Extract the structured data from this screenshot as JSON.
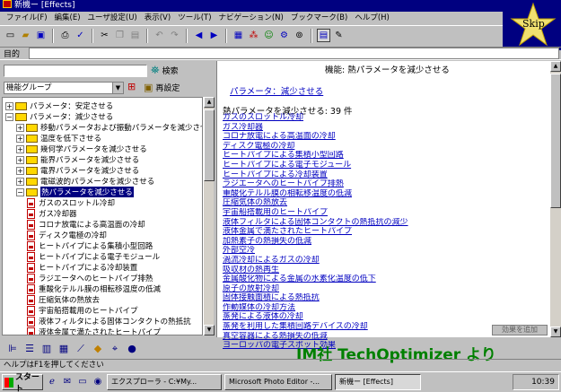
{
  "window": {
    "title": "新機ー [Effects]"
  },
  "menu": [
    "ファイル(F)",
    "編集(E)",
    "ユーザ設定(U)",
    "表示(V)",
    "ツール(T)",
    "ナビゲーション(N)",
    "ブックマーク(B)",
    "ヘルプ(H)"
  ],
  "skip_label": "Skip",
  "goal": {
    "label": "目的"
  },
  "search": {
    "button_label": "検索"
  },
  "group_select": {
    "value": "機能グループ"
  },
  "reset": {
    "label": "再設定"
  },
  "tree": [
    {
      "label": "パラメータ：安定させる",
      "kind": "folder",
      "expand": "+",
      "level": 0
    },
    {
      "label": "パラメータ：減少させる",
      "kind": "folder",
      "expand": "−",
      "level": 0
    },
    {
      "label": "移動パラメータおよび振動パラメータを減少させる",
      "kind": "folder",
      "expand": "+",
      "level": 1
    },
    {
      "label": "温度を低下させる",
      "kind": "folder",
      "expand": "+",
      "level": 1
    },
    {
      "label": "幾何学パラメータを減少させる",
      "kind": "folder",
      "expand": "+",
      "level": 1
    },
    {
      "label": "能界パラメータを減少させる",
      "kind": "folder",
      "expand": "+",
      "level": 1
    },
    {
      "label": "電界パラメータを減少させる",
      "kind": "folder",
      "expand": "+",
      "level": 1
    },
    {
      "label": "電磁波的パラメータを減少させる",
      "kind": "folder",
      "expand": "+",
      "level": 1
    },
    {
      "label": "熱パラメータを減少させる",
      "kind": "folder",
      "expand": "−",
      "level": 1,
      "selected": true
    },
    {
      "label": "ガスのスロットル冷却",
      "kind": "doc",
      "level": 2
    },
    {
      "label": "ガス冷却器",
      "kind": "doc",
      "level": 2
    },
    {
      "label": "コロナ放電による高温面の冷却",
      "kind": "doc",
      "level": 2
    },
    {
      "label": "ディスク電極の冷却",
      "kind": "doc",
      "level": 2
    },
    {
      "label": "ヒートパイプによる集積小型回路",
      "kind": "doc",
      "level": 2
    },
    {
      "label": "ヒートパイプによる電子モジュール",
      "kind": "doc",
      "level": 2
    },
    {
      "label": "ヒートパイプによる冷却装置",
      "kind": "doc",
      "level": 2
    },
    {
      "label": "ラジエータへのヒートパイプ排熱",
      "kind": "doc",
      "level": 2
    },
    {
      "label": "重酸化テルル膜の相転移温度の低減",
      "kind": "doc",
      "level": 2
    },
    {
      "label": "圧縮気体の熱放去",
      "kind": "doc",
      "level": 2
    },
    {
      "label": "宇宙船搭載用のヒートパイプ",
      "kind": "doc",
      "level": 2
    },
    {
      "label": "液体フィルタによる固体コンタクトの熱抵抗",
      "kind": "doc",
      "level": 2
    },
    {
      "label": "液体金属で満たされたヒートパイプ",
      "kind": "doc",
      "level": 2
    }
  ],
  "right": {
    "heading": "機能: 熱パラメータを減少させる",
    "function_link": "パラメータ：減少させる",
    "count_text": "熱パラメータを減少させる: 39 件",
    "effects": [
      "ガスのスロットル冷却",
      "ガス冷却器",
      "コロナ放電による高温面の冷却",
      "ディスク電極の冷却",
      "ヒートパイプによる集積小型回路",
      "ヒートパイプによる電子モジュール",
      "ヒートパイプによる冷却装置",
      "ラジエータへのヒートパイプ排熱",
      "重酸化テルル膜の相転移温度の低減",
      "圧縮気体の熱放去",
      "宇宙船搭載用のヒートパイプ",
      "液体フィルタによる固体コンタクトの熱抵抗の減少",
      "液体金属で満たされたヒートパイプ",
      "加熱素子の熱損失の低減",
      "外部空冷",
      "渦流冷却によるガスの冷却",
      "吸収材の熱再生",
      "金属酸化物による金属の水素化温度の低下",
      "原子の放射冷却",
      "固体接触面積による熱抵抗",
      "作動媒体の冷却方法",
      "蒸発による液体の冷却",
      "蒸発を利用した集積回路デバイスの冷却",
      "真空容器による熱損失の低減",
      "ヨーロッパの電子スポット効果"
    ],
    "add_button": "効果を追加"
  },
  "watermark": "IM社 TechOptimizer より",
  "status": "ヘルプはF1を押してください",
  "taskbar": {
    "start": "スタート",
    "tasks": [
      {
        "label": "エクスプローラ - C:¥My...",
        "active": false
      },
      {
        "label": "Microsoft Photo Editor -...",
        "active": false
      },
      {
        "label": "新機ー [Effects]",
        "active": true
      }
    ],
    "clock": "10:39"
  }
}
